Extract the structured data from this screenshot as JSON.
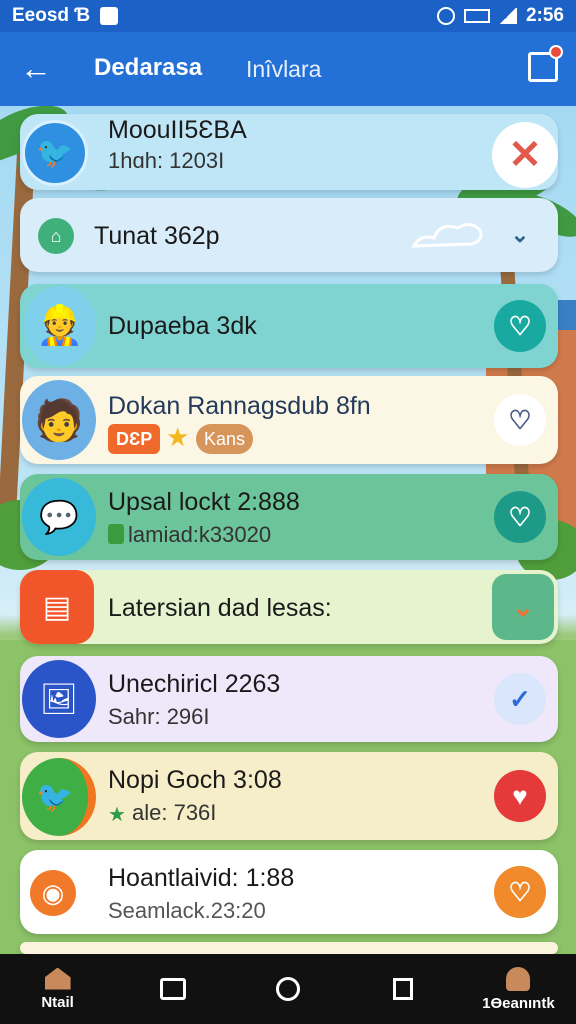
{
  "status_bar": {
    "left_text": "Eeosd Ɓ",
    "time": "2:56",
    "icons": [
      "notification-icon",
      "alarm-icon",
      "battery-icon",
      "signal-icon"
    ]
  },
  "app_bar": {
    "title": "Dedarasa",
    "subtitle": "Inîvlara",
    "icons": [
      "back-arrow-icon",
      "menu-icon"
    ]
  },
  "list": {
    "items": [
      {
        "title": "MoouII5ƐBA",
        "subtitle": "1hɑh: 1203I",
        "icon": "twitter-bird-icon",
        "action": "close-icon",
        "bg": "#bfe6f6",
        "action_color": "#e2584a"
      },
      {
        "title": "Tunat 362p",
        "subtitle": "",
        "icon": "home-icon",
        "action": "chevron-down-icon",
        "bg": "#d8ecfa",
        "action_color": "#2f5f8a"
      },
      {
        "title": "Dupaeba 3dk",
        "subtitle": "",
        "icon": "avatar-worker-icon",
        "action": "heart-icon",
        "bg": "#7fd3d1",
        "action_color": "#18a9a0"
      },
      {
        "title": "Dokan Rannagsdub 8fn",
        "subtitle": "",
        "badges": [
          "DƐP",
          "Kans"
        ],
        "icon": "avatar-man-icon",
        "action": "heart-outline-icon",
        "bg": "#fbf7e4",
        "action_color": "#4a5a8a"
      },
      {
        "title": "Upsal lockt 2:888",
        "subtitle": "lamiad:k33020",
        "icon": "chat-star-icon",
        "action": "heart-icon",
        "bg": "#6cc49a",
        "action_color": "#1d9b88"
      },
      {
        "title": "Latersian dad lesas:",
        "subtitle": "",
        "icon": "calendar-icon",
        "action": "check-icon",
        "bg": "#e6f3cf",
        "action_color": "#5cb88a"
      },
      {
        "title": "Unechiricl 2263",
        "subtitle": "Sahr: 296I",
        "icon": "gallery-icon",
        "action": "check-icon",
        "bg": "#efe8fb",
        "action_color": "#2c6ad8"
      },
      {
        "title": "Nopi Goch 3:08",
        "subtitle": "ale: 736I",
        "icon": "twitter-bird-icon",
        "action": "heart-icon",
        "bg": "#f6eec8",
        "action_color": "#e43a3a"
      },
      {
        "title": "Hoantlaivid: 1:88",
        "subtitle": "Seamlack.23:20",
        "icon": "flame-icon",
        "action": "heart-icon",
        "bg": "#ffffff",
        "action_color": "#f08a2a"
      }
    ]
  },
  "bottom_nav": {
    "items": [
      {
        "label": "Ntail",
        "icon": "home-icon"
      },
      {
        "label": "",
        "icon": "tablet-icon"
      },
      {
        "label": "",
        "icon": "compass-icon"
      },
      {
        "label": "",
        "icon": "square-icon"
      },
      {
        "label": "1Ɵeanıntk",
        "icon": "profile-icon"
      }
    ]
  }
}
